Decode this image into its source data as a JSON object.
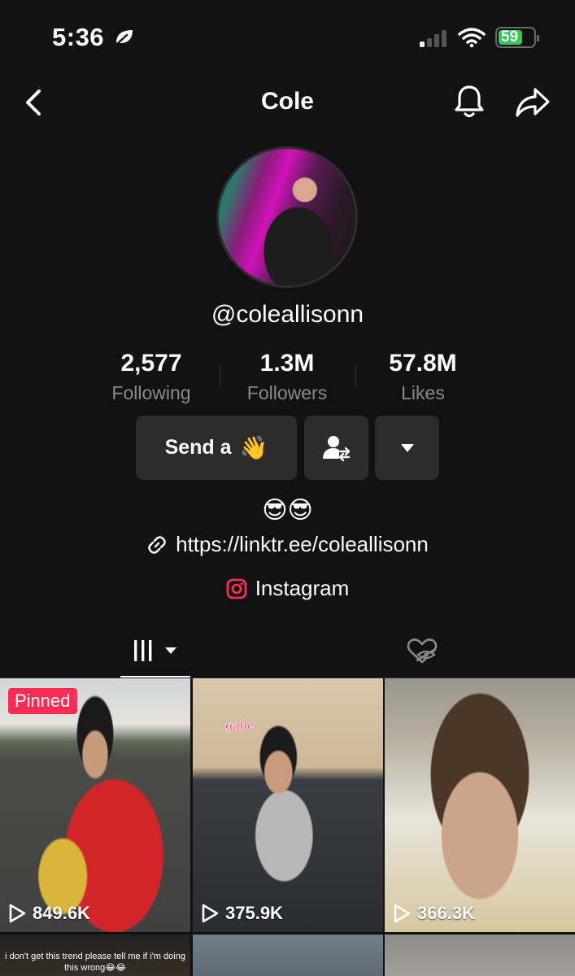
{
  "status_bar": {
    "time": "5:36",
    "battery": "59",
    "battery_level": 0.59
  },
  "header": {
    "title": "Cole"
  },
  "profile": {
    "username": "@coleallisonn",
    "stats": [
      {
        "value": "2,577",
        "label": "Following"
      },
      {
        "value": "1.3M",
        "label": "Followers"
      },
      {
        "value": "57.8M",
        "label": "Likes"
      }
    ],
    "wave_button_label": "Send a",
    "wave_emoji": "👋",
    "bio": "😎😎",
    "link": "https://linktr.ee/coleallisonn",
    "instagram_label": "Instagram"
  },
  "colors": {
    "accent": "#fe2c55",
    "background": "#121212",
    "button_bg": "#2c2c2c",
    "secondary_text": "#8a8a8a"
  },
  "videos": [
    {
      "pinned_label": "Pinned",
      "views": "849.6K"
    },
    {
      "overlay_text": "gabe",
      "views": "375.9K"
    },
    {
      "views": "366.3K"
    },
    {
      "overlay_text": "i don't get this trend please tell me if i'm doing this wrong😂😂"
    },
    {},
    {}
  ]
}
